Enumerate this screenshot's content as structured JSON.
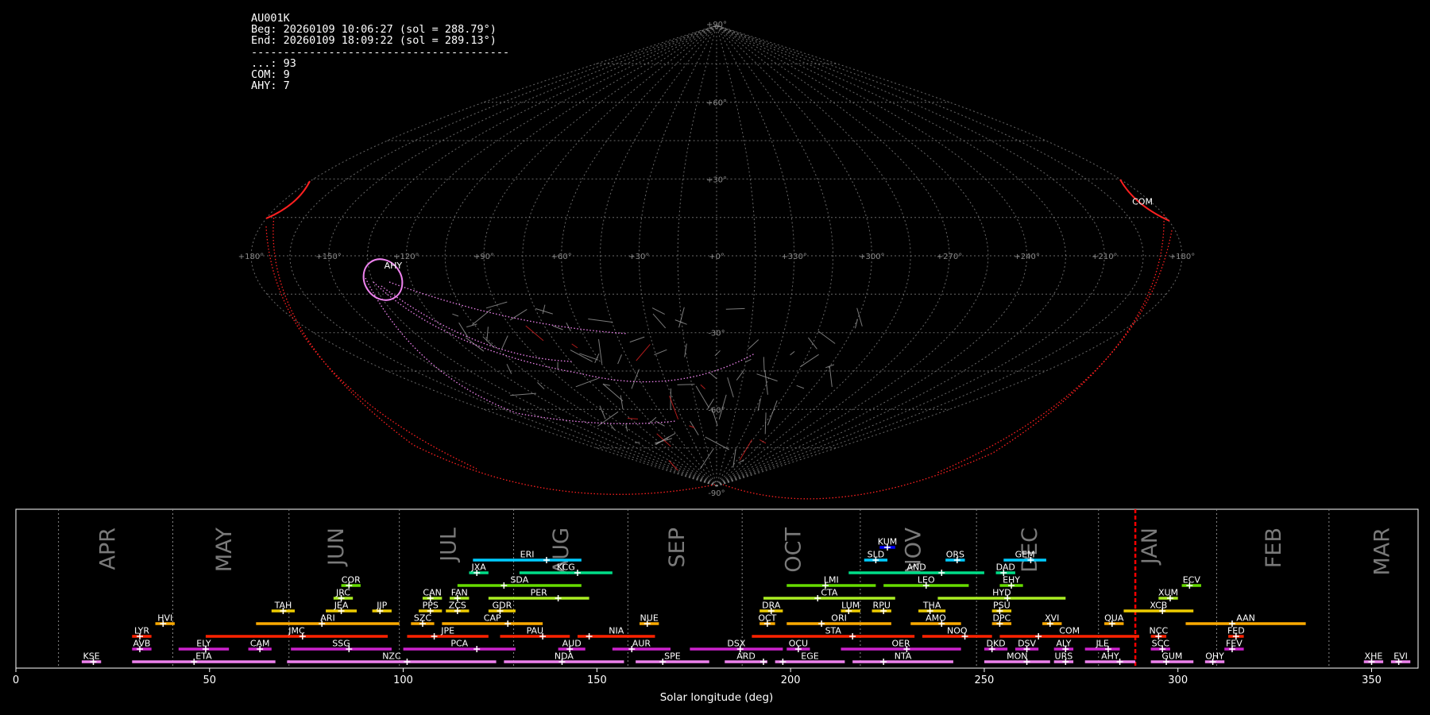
{
  "stats": {
    "station": "AU001K",
    "beg": "Beg: 20260109 10:06:27 (sol = 288.79°)",
    "end": "End: 20260109 18:09:22 (sol = 289.13°)",
    "separator": "----------------------------------------",
    "counts": [
      "...: 93",
      "COM: 9",
      "AHY: 7"
    ]
  },
  "skymap": {
    "lat_labels": [
      {
        "lat": 90,
        "text": "+90°"
      },
      {
        "lat": 60,
        "text": "+60°"
      },
      {
        "lat": 30,
        "text": "+30°"
      },
      {
        "lat": -30,
        "text": "-30°"
      },
      {
        "lat": -60,
        "text": "-60°"
      },
      {
        "lat": -90,
        "text": "-90°"
      }
    ],
    "lon_labels": [
      {
        "lon": 180,
        "text": "+180°"
      },
      {
        "lon": 150,
        "text": "+150°"
      },
      {
        "lon": 120,
        "text": "+120°"
      },
      {
        "lon": 90,
        "text": "+90°"
      },
      {
        "lon": 60,
        "text": "+60°"
      },
      {
        "lon": 30,
        "text": "+30°"
      },
      {
        "lon": 0,
        "text": "+0°"
      },
      {
        "lon": -30,
        "text": "+330°"
      },
      {
        "lon": -60,
        "text": "+300°"
      },
      {
        "lon": -90,
        "text": "+270°"
      },
      {
        "lon": -120,
        "text": "+240°"
      },
      {
        "lon": -150,
        "text": "+210°"
      },
      {
        "lon": -180,
        "text": "+180°"
      }
    ],
    "shower_labels": [
      {
        "name": "AHY",
        "lon": 129,
        "lat": -5,
        "color": "#ff88ff"
      },
      {
        "name": "COM",
        "lon": -171,
        "lat": 20,
        "color": "#ff2020"
      }
    ],
    "colors": {
      "sporadic": "#9a9a9a",
      "com": "#ff2020",
      "ahy": "#ee82ee"
    }
  },
  "chart_data": {
    "type": "gantt",
    "xlabel": "Solar longitude (deg)",
    "xlim": [
      0,
      362
    ],
    "xticks": [
      0,
      50,
      100,
      150,
      200,
      250,
      300,
      350
    ],
    "current_sol": 289,
    "months": [
      {
        "name": "APR",
        "start": 11,
        "label_at": 24
      },
      {
        "name": "MAY",
        "start": 40.5,
        "label_at": 54
      },
      {
        "name": "JUN",
        "start": 70.5,
        "label_at": 83
      },
      {
        "name": "JUL",
        "start": 99,
        "label_at": 112
      },
      {
        "name": "AUG",
        "start": 128.5,
        "label_at": 141
      },
      {
        "name": "SEP",
        "start": 158,
        "label_at": 171
      },
      {
        "name": "OCT",
        "start": 187.5,
        "label_at": 201
      },
      {
        "name": "NOV",
        "start": 218,
        "label_at": 232
      },
      {
        "name": "DEC",
        "start": 248,
        "label_at": 262
      },
      {
        "name": "JAN",
        "start": 279.5,
        "label_at": 293
      },
      {
        "name": "FEB",
        "start": 310,
        "label_at": 325
      },
      {
        "name": "MAR",
        "start": 339,
        "label_at": 353
      }
    ],
    "showers": [
      {
        "code": "KUM",
        "start": 223,
        "end": 227,
        "peak": 225,
        "row": 10,
        "color": "#0000ff"
      },
      {
        "code": "ERI",
        "start": 118,
        "end": 146,
        "peak": 137,
        "row": 9,
        "color": "#00ccff"
      },
      {
        "code": "SLD",
        "start": 219,
        "end": 225,
        "peak": 222,
        "row": 9,
        "color": "#00ccff"
      },
      {
        "code": "ORS",
        "start": 240,
        "end": 245,
        "peak": 243,
        "row": 9,
        "color": "#00ccff"
      },
      {
        "code": "GEM",
        "start": 255,
        "end": 266,
        "peak": 262,
        "row": 9,
        "color": "#00ccff"
      },
      {
        "code": "JXA",
        "start": 117,
        "end": 122,
        "peak": 119,
        "row": 8,
        "color": "#00dd88"
      },
      {
        "code": "KCG",
        "start": 130,
        "end": 154,
        "peak": 145,
        "row": 8,
        "color": "#00dd88"
      },
      {
        "code": "AND",
        "start": 215,
        "end": 250,
        "peak": 239,
        "row": 8,
        "color": "#00dd88"
      },
      {
        "code": "DAD",
        "start": 253,
        "end": 258,
        "peak": 255,
        "row": 8,
        "color": "#00dd88"
      },
      {
        "code": "COR",
        "start": 84,
        "end": 89,
        "peak": 86,
        "row": 7,
        "color": "#66dd00"
      },
      {
        "code": "SDA",
        "start": 114,
        "end": 146,
        "peak": 126,
        "row": 7,
        "color": "#66dd00"
      },
      {
        "code": "LMI",
        "start": 199,
        "end": 222,
        "peak": 209,
        "row": 7,
        "color": "#66dd00"
      },
      {
        "code": "LEO",
        "start": 224,
        "end": 246,
        "peak": 235,
        "row": 7,
        "color": "#66dd00"
      },
      {
        "code": "EHY",
        "start": 254,
        "end": 260,
        "peak": 257,
        "row": 7,
        "color": "#66dd00"
      },
      {
        "code": "ECV",
        "start": 301,
        "end": 306,
        "peak": 303,
        "row": 7,
        "color": "#66dd00"
      },
      {
        "code": "JRC",
        "start": 82,
        "end": 87,
        "peak": 84,
        "row": 6,
        "color": "#aaee22"
      },
      {
        "code": "CAN",
        "start": 105,
        "end": 110,
        "peak": 107,
        "row": 6,
        "color": "#aaee22"
      },
      {
        "code": "FAN",
        "start": 112,
        "end": 117,
        "peak": 114,
        "row": 6,
        "color": "#aaee22"
      },
      {
        "code": "PER",
        "start": 122,
        "end": 148,
        "peak": 140,
        "row": 6,
        "color": "#aaee22"
      },
      {
        "code": "CTA",
        "start": 193,
        "end": 227,
        "peak": 207,
        "row": 6,
        "color": "#aaee22"
      },
      {
        "code": "HYD",
        "start": 238,
        "end": 271,
        "peak": 256,
        "row": 6,
        "color": "#aaee22"
      },
      {
        "code": "XUM",
        "start": 295,
        "end": 300,
        "peak": 298,
        "row": 6,
        "color": "#aaee22"
      },
      {
        "code": "TAH",
        "start": 66,
        "end": 72,
        "peak": 69,
        "row": 5,
        "color": "#eecc00"
      },
      {
        "code": "JEA",
        "start": 80,
        "end": 88,
        "peak": 84,
        "row": 5,
        "color": "#eecc00"
      },
      {
        "code": "JIP",
        "start": 92,
        "end": 97,
        "peak": 94,
        "row": 5,
        "color": "#eecc00"
      },
      {
        "code": "PPS",
        "start": 104,
        "end": 110,
        "peak": 107,
        "row": 5,
        "color": "#eecc00"
      },
      {
        "code": "ZCS",
        "start": 111,
        "end": 117,
        "peak": 114,
        "row": 5,
        "color": "#eecc00"
      },
      {
        "code": "GDR",
        "start": 122,
        "end": 129,
        "peak": 125,
        "row": 5,
        "color": "#eecc00"
      },
      {
        "code": "DRA",
        "start": 192,
        "end": 198,
        "peak": 195,
        "row": 5,
        "color": "#eecc00"
      },
      {
        "code": "LUM",
        "start": 213,
        "end": 218,
        "peak": 215,
        "row": 5,
        "color": "#eecc00"
      },
      {
        "code": "RPU",
        "start": 221,
        "end": 226,
        "peak": 224,
        "row": 5,
        "color": "#eecc00"
      },
      {
        "code": "THA",
        "start": 233,
        "end": 240,
        "peak": 236,
        "row": 5,
        "color": "#eecc00"
      },
      {
        "code": "PSU",
        "start": 252,
        "end": 257,
        "peak": 254,
        "row": 5,
        "color": "#eecc00"
      },
      {
        "code": "XCB",
        "start": 286,
        "end": 304,
        "peak": 296,
        "row": 5,
        "color": "#eecc00"
      },
      {
        "code": "HVI",
        "start": 36,
        "end": 41,
        "peak": 38,
        "row": 4,
        "color": "#ffaa00"
      },
      {
        "code": "ARI",
        "start": 62,
        "end": 99,
        "peak": 79,
        "row": 4,
        "color": "#ffaa00"
      },
      {
        "code": "SZC",
        "start": 102,
        "end": 108,
        "peak": 105,
        "row": 4,
        "color": "#ffaa00"
      },
      {
        "code": "CAP",
        "start": 110,
        "end": 136,
        "peak": 127,
        "row": 4,
        "color": "#ffaa00"
      },
      {
        "code": "NUE",
        "start": 161,
        "end": 166,
        "peak": 163,
        "row": 4,
        "color": "#ffaa00"
      },
      {
        "code": "OCT",
        "start": 192,
        "end": 196,
        "peak": 194,
        "row": 4,
        "color": "#ffaa00"
      },
      {
        "code": "ORI",
        "start": 199,
        "end": 226,
        "peak": 208,
        "row": 4,
        "color": "#ffaa00"
      },
      {
        "code": "AMO",
        "start": 231,
        "end": 244,
        "peak": 239,
        "row": 4,
        "color": "#ffaa00"
      },
      {
        "code": "DPC",
        "start": 252,
        "end": 257,
        "peak": 254,
        "row": 4,
        "color": "#ffaa00"
      },
      {
        "code": "XVI",
        "start": 265,
        "end": 270,
        "peak": 267,
        "row": 4,
        "color": "#ffaa00"
      },
      {
        "code": "QUA",
        "start": 281,
        "end": 286,
        "peak": 283,
        "row": 4,
        "color": "#ffaa00"
      },
      {
        "code": "AAN",
        "start": 302,
        "end": 333,
        "peak": 314,
        "row": 4,
        "color": "#ffaa00"
      },
      {
        "code": "LYR",
        "start": 30,
        "end": 35,
        "peak": 32,
        "row": 3,
        "color": "#ff2200"
      },
      {
        "code": "JMC",
        "start": 49,
        "end": 96,
        "peak": 74,
        "row": 3,
        "color": "#ff2200"
      },
      {
        "code": "JPE",
        "start": 101,
        "end": 122,
        "peak": 108,
        "row": 3,
        "color": "#ff2200"
      },
      {
        "code": "PAU",
        "start": 125,
        "end": 143,
        "peak": 136,
        "row": 3,
        "color": "#ff2200"
      },
      {
        "code": "NIA",
        "start": 145,
        "end": 165,
        "peak": 148,
        "row": 3,
        "color": "#ff2200"
      },
      {
        "code": "STA",
        "start": 190,
        "end": 232,
        "peak": 216,
        "row": 3,
        "color": "#ff2200"
      },
      {
        "code": "NOO",
        "start": 234,
        "end": 252,
        "peak": 245,
        "row": 3,
        "color": "#ff2200"
      },
      {
        "code": "COM",
        "start": 254,
        "end": 290,
        "peak": 264,
        "row": 3,
        "color": "#ff2200"
      },
      {
        "code": "NCC",
        "start": 293,
        "end": 297,
        "peak": 295,
        "row": 3,
        "color": "#ff2200"
      },
      {
        "code": "FED",
        "start": 313,
        "end": 317,
        "peak": 315,
        "row": 3,
        "color": "#ff2200"
      },
      {
        "code": "AVB",
        "start": 30,
        "end": 35,
        "peak": 32,
        "row": 2,
        "color": "#cc22cc"
      },
      {
        "code": "ELY",
        "start": 42,
        "end": 55,
        "peak": 49,
        "row": 2,
        "color": "#cc22cc"
      },
      {
        "code": "CAM",
        "start": 60,
        "end": 66,
        "peak": 63,
        "row": 2,
        "color": "#cc22cc"
      },
      {
        "code": "SSG",
        "start": 71,
        "end": 97,
        "peak": 86,
        "row": 2,
        "color": "#cc22cc"
      },
      {
        "code": "PCA",
        "start": 100,
        "end": 129,
        "peak": 119,
        "row": 2,
        "color": "#cc22cc"
      },
      {
        "code": "AUD",
        "start": 140,
        "end": 147,
        "peak": 143,
        "row": 2,
        "color": "#cc22cc"
      },
      {
        "code": "AUR",
        "start": 154,
        "end": 169,
        "peak": 159,
        "row": 2,
        "color": "#cc22cc"
      },
      {
        "code": "DSX",
        "start": 174,
        "end": 198,
        "peak": 187,
        "row": 2,
        "color": "#cc22cc"
      },
      {
        "code": "OCU",
        "start": 199,
        "end": 205,
        "peak": 202,
        "row": 2,
        "color": "#cc22cc"
      },
      {
        "code": "OER",
        "start": 213,
        "end": 244,
        "peak": 230,
        "row": 2,
        "color": "#cc22cc"
      },
      {
        "code": "DKD",
        "start": 250,
        "end": 256,
        "peak": 252,
        "row": 2,
        "color": "#cc22cc"
      },
      {
        "code": "DSV",
        "start": 258,
        "end": 264,
        "peak": 261,
        "row": 2,
        "color": "#cc22cc"
      },
      {
        "code": "ALY",
        "start": 268,
        "end": 273,
        "peak": 271,
        "row": 2,
        "color": "#cc22cc"
      },
      {
        "code": "JLE",
        "start": 276,
        "end": 285,
        "peak": 282,
        "row": 2,
        "color": "#cc22cc"
      },
      {
        "code": "SCC",
        "start": 293,
        "end": 298,
        "peak": 296,
        "row": 2,
        "color": "#cc22cc"
      },
      {
        "code": "FEV",
        "start": 312,
        "end": 317,
        "peak": 314,
        "row": 2,
        "color": "#cc22cc"
      },
      {
        "code": "KSE",
        "start": 17,
        "end": 22,
        "peak": 20,
        "row": 1,
        "color": "#ee82ee"
      },
      {
        "code": "ETA",
        "start": 30,
        "end": 67,
        "peak": 46,
        "row": 1,
        "color": "#ee82ee"
      },
      {
        "code": "NZC",
        "start": 70,
        "end": 124,
        "peak": 101,
        "row": 1,
        "color": "#ee82ee"
      },
      {
        "code": "NDA",
        "start": 126,
        "end": 157,
        "peak": 141,
        "row": 1,
        "color": "#ee82ee"
      },
      {
        "code": "SPE",
        "start": 160,
        "end": 179,
        "peak": 167,
        "row": 1,
        "color": "#ee82ee"
      },
      {
        "code": "ARD",
        "start": 183,
        "end": 194,
        "peak": 193,
        "row": 1,
        "color": "#ee82ee"
      },
      {
        "code": "EGE",
        "start": 196,
        "end": 214,
        "peak": 198,
        "row": 1,
        "color": "#ee82ee"
      },
      {
        "code": "NTA",
        "start": 216,
        "end": 242,
        "peak": 224,
        "row": 1,
        "color": "#ee82ee"
      },
      {
        "code": "MON",
        "start": 250,
        "end": 267,
        "peak": 261,
        "row": 1,
        "color": "#ee82ee"
      },
      {
        "code": "URS",
        "start": 268,
        "end": 273,
        "peak": 271,
        "row": 1,
        "color": "#ee82ee"
      },
      {
        "code": "AHY",
        "start": 276,
        "end": 289,
        "peak": 285,
        "row": 1,
        "color": "#ee82ee"
      },
      {
        "code": "GUM",
        "start": 293,
        "end": 304,
        "peak": 297,
        "row": 1,
        "color": "#ee82ee"
      },
      {
        "code": "OHY",
        "start": 307,
        "end": 312,
        "peak": 309,
        "row": 1,
        "color": "#ee82ee"
      },
      {
        "code": "XHE",
        "start": 348,
        "end": 353,
        "peak": 350,
        "row": 1,
        "color": "#ee82ee"
      },
      {
        "code": "EVI",
        "start": 355,
        "end": 360,
        "peak": 357,
        "row": 1,
        "color": "#ee82ee"
      }
    ]
  }
}
